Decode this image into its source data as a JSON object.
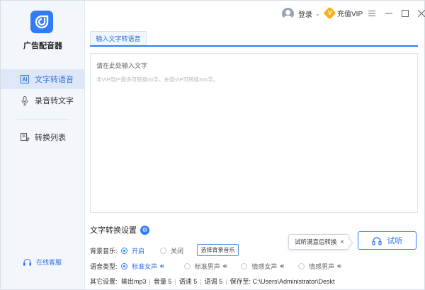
{
  "app": {
    "name": "广告配音器"
  },
  "sidebar": {
    "items": [
      {
        "label": "文字转语音",
        "icon": "text-to-speech-icon",
        "active": true
      },
      {
        "label": "录音转文字",
        "icon": "microphone-icon",
        "active": false
      },
      {
        "label": "转换列表",
        "icon": "convert-list-icon",
        "active": false
      }
    ],
    "service_label": "在线客服"
  },
  "titlebar": {
    "login_label": "登录",
    "vip_label": "充值VIP",
    "vip_badge": "V"
  },
  "tabs": [
    {
      "label": "输入文字转语音",
      "active": true
    }
  ],
  "editor": {
    "placeholder": "请在此处输入文字",
    "hint": "非VIP用户最多可转换50字，充值VIP可转换300字。"
  },
  "settings": {
    "title": "文字转换设置",
    "bg_music": {
      "label": "背景音乐:",
      "options": [
        {
          "label": "开启",
          "selected": true
        },
        {
          "label": "关闭",
          "selected": false
        }
      ],
      "choose_button": "选择背景音乐"
    },
    "voice": {
      "label": "语音类型:",
      "options": [
        {
          "label": "标准女声",
          "selected": true
        },
        {
          "label": "标准男声",
          "selected": false
        },
        {
          "label": "情感女声",
          "selected": false
        },
        {
          "label": "情感男声",
          "selected": false
        }
      ]
    },
    "other": {
      "label": "其它设置:",
      "format": "输出mp3",
      "volume": "音量 5",
      "speed": "语速 5",
      "pitch": "语调 5",
      "save_path": "保存至: C:\\Users\\Administrator\\Deskt"
    }
  },
  "tooltip": {
    "text": "试听满意后转换"
  },
  "try_button": {
    "label": "试听"
  },
  "colors": {
    "accent": "#2f7cf6",
    "sidebar_bg": "#f3f6fb",
    "active_nav_bg": "#dde7f7",
    "vip": "#f5b21f"
  }
}
